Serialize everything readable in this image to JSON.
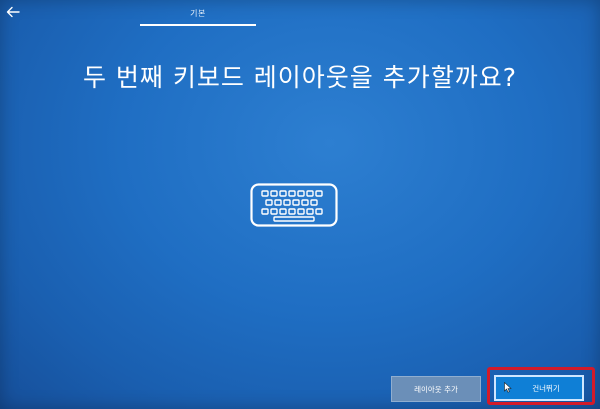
{
  "header": {
    "back_icon": "back-arrow-icon",
    "tab_label": "기본"
  },
  "main": {
    "title": "두 번째 키보드 레이아웃을 추가할까요?",
    "icon": "keyboard-icon"
  },
  "footer": {
    "add_layout_label": "레이아웃 추가",
    "skip_label": "건너뛰기",
    "cursor_icon": "mouse-pointer-icon"
  },
  "colors": {
    "background": "#1f6ec3",
    "primary_button": "#0f7fd6",
    "secondary_button": "#6b8fb8",
    "highlight_frame": "#d21b2a"
  }
}
